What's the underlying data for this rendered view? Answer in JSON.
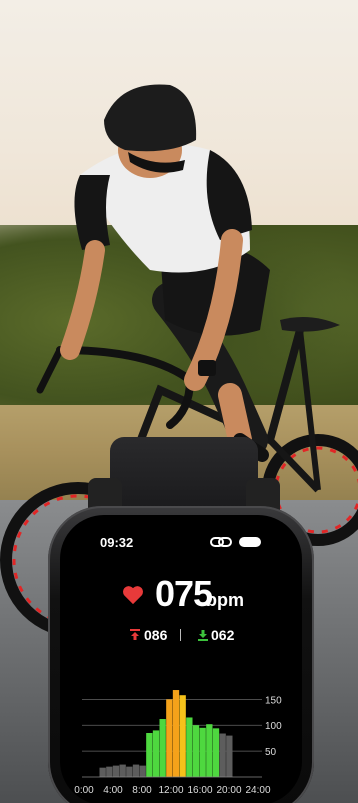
{
  "status_bar": {
    "time": "09:32"
  },
  "heart_rate": {
    "value": "075",
    "unit": "bpm",
    "high": "086",
    "low": "062"
  },
  "colors": {
    "heart": "#e83a3a",
    "up_arrow": "#e83a3a",
    "down_arrow": "#3cc23c"
  },
  "chart_data": {
    "type": "bar",
    "x_ticks": [
      "0:00",
      "4:00",
      "8:00",
      "12:00",
      "16:00",
      "20:00",
      "24:00"
    ],
    "y_ticks": [
      50,
      100,
      150
    ],
    "ylim": [
      0,
      170
    ],
    "xlim": [
      0,
      24
    ],
    "values": [
      {
        "x": 1,
        "y": 18,
        "c": "#5d5d5d"
      },
      {
        "x": 2,
        "y": 20,
        "c": "#5d5d5d"
      },
      {
        "x": 3,
        "y": 22,
        "c": "#5d5d5d"
      },
      {
        "x": 4,
        "y": 24,
        "c": "#5d5d5d"
      },
      {
        "x": 5,
        "y": 20,
        "c": "#5d5d5d"
      },
      {
        "x": 6,
        "y": 24,
        "c": "#5d5d5d"
      },
      {
        "x": 7,
        "y": 22,
        "c": "#5d5d5d"
      },
      {
        "x": 8,
        "y": 85,
        "c": "#4ed83f"
      },
      {
        "x": 9,
        "y": 90,
        "c": "#4ed83f"
      },
      {
        "x": 10,
        "y": 112,
        "c": "#4ed83f"
      },
      {
        "x": 11,
        "y": 150,
        "c": "#f5a21a"
      },
      {
        "x": 12,
        "y": 168,
        "c": "#f5a21a"
      },
      {
        "x": 13,
        "y": 158,
        "c": "#f5c21a"
      },
      {
        "x": 14,
        "y": 115,
        "c": "#4ed83f"
      },
      {
        "x": 15,
        "y": 100,
        "c": "#4ed83f"
      },
      {
        "x": 16,
        "y": 95,
        "c": "#4ed83f"
      },
      {
        "x": 17,
        "y": 102,
        "c": "#4ed83f"
      },
      {
        "x": 18,
        "y": 94,
        "c": "#4ed83f"
      },
      {
        "x": 19,
        "y": 84,
        "c": "#5d5d5d"
      },
      {
        "x": 20,
        "y": 80,
        "c": "#5d5d5d"
      }
    ]
  }
}
